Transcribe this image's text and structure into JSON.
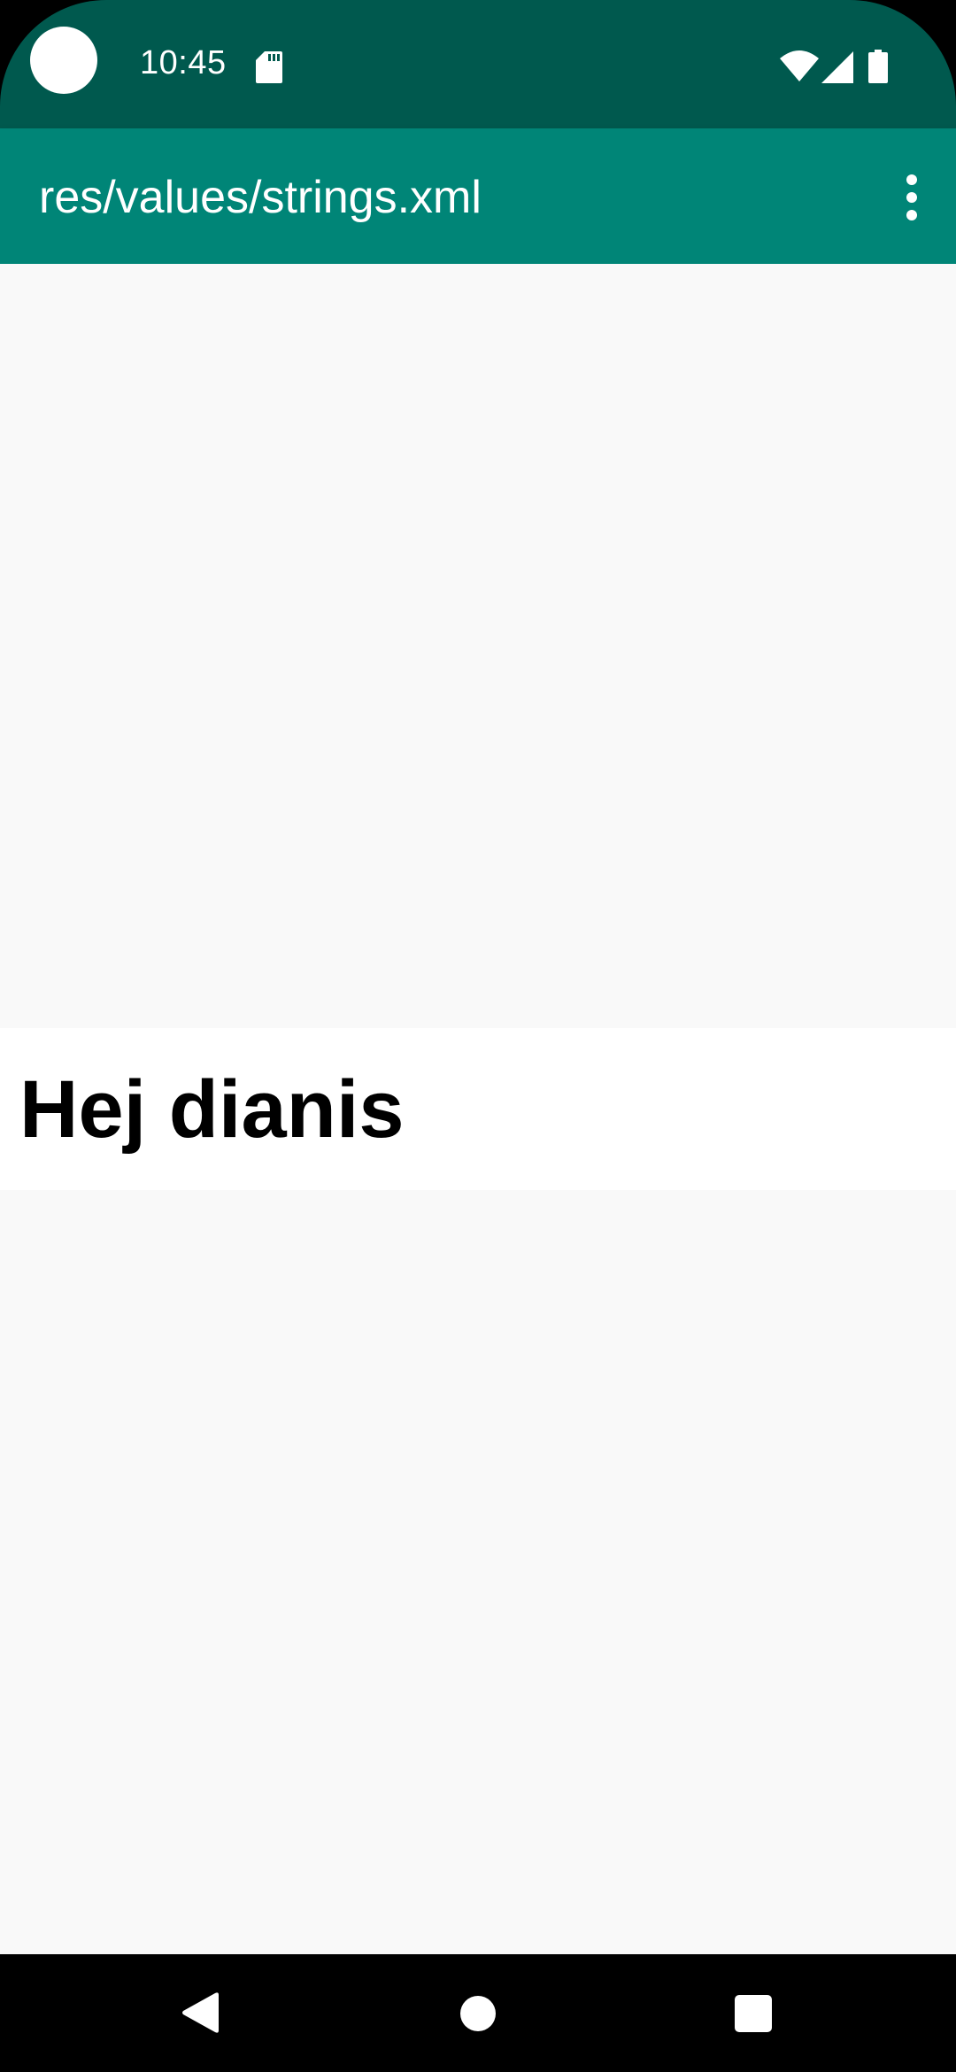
{
  "status_bar": {
    "time": "10:45",
    "icons": [
      "camera-cutout",
      "sd-card-icon",
      "wifi-icon",
      "cell-signal-icon",
      "battery-icon"
    ],
    "background_color": "#00594e"
  },
  "app_bar": {
    "title": "res/values/strings.xml",
    "overflow_icon": "more-vert-icon",
    "background_color": "#008577"
  },
  "content": {
    "message": "Hej dianis",
    "background_color": "#f9f9f9",
    "message_background": "#ffffff"
  },
  "nav_bar": {
    "icons": [
      "back-icon",
      "home-icon",
      "recents-icon"
    ]
  }
}
